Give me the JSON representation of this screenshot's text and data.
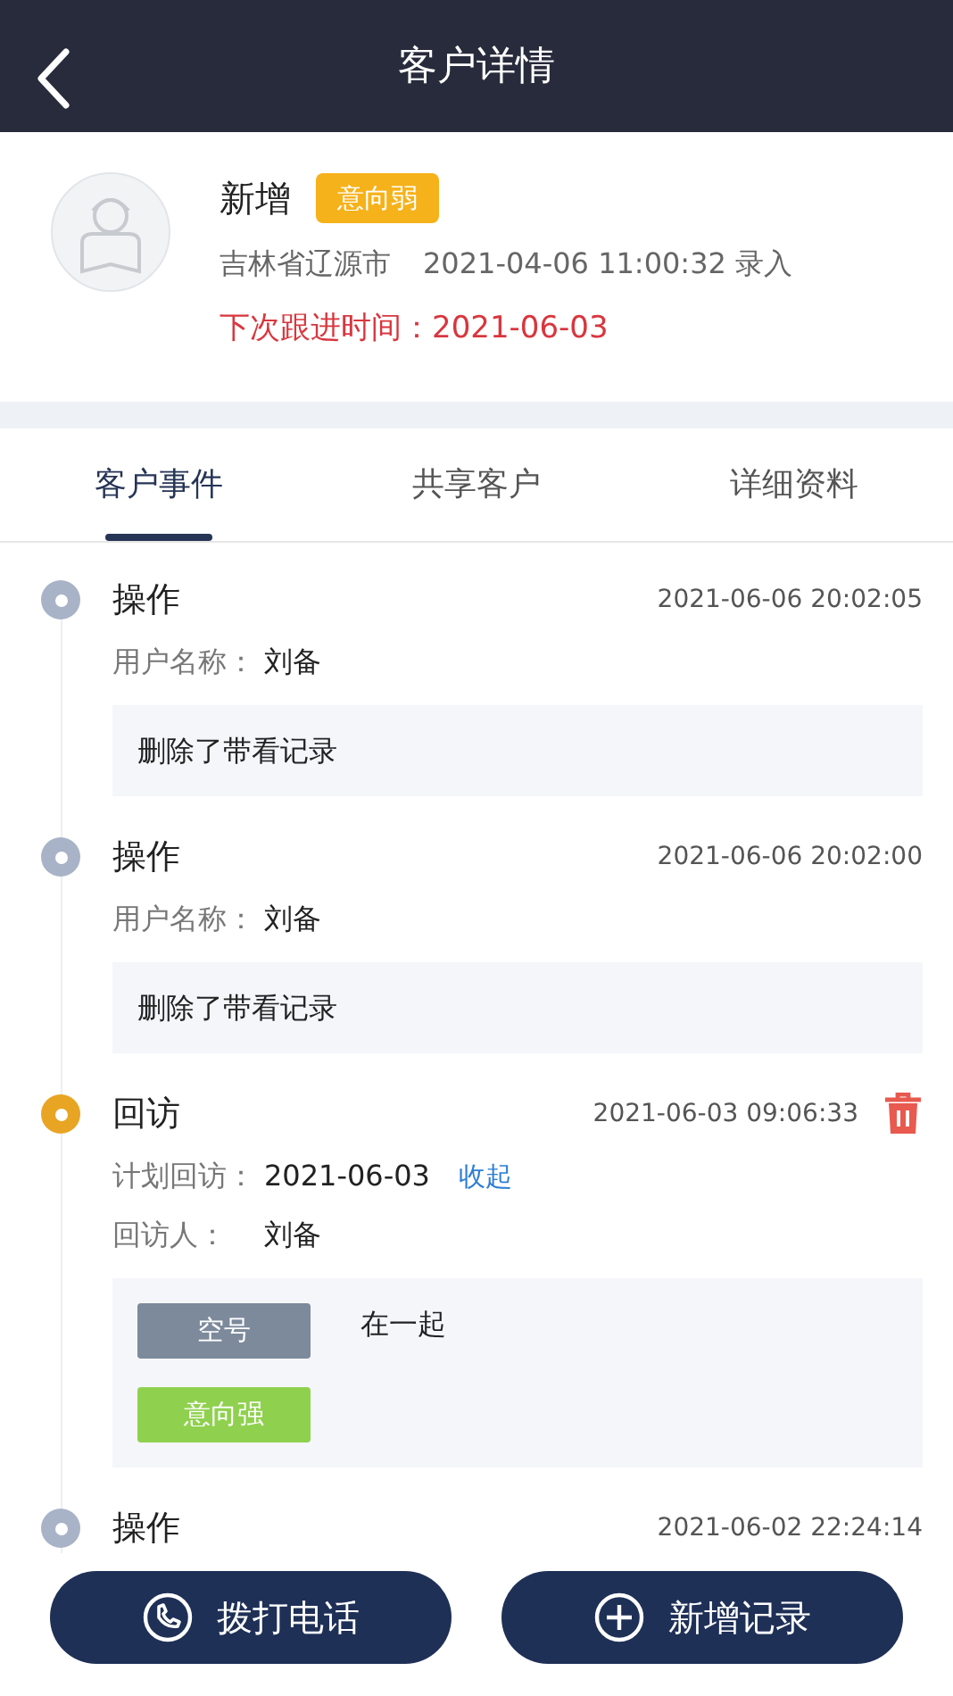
{
  "header": {
    "title": "客户详情"
  },
  "customer": {
    "name": "新增",
    "tag": {
      "label": "意向弱",
      "color": "#f6b21b"
    },
    "location": "吉林省辽源市",
    "created": "2021-04-06 11:00:32 录入",
    "followup": "下次跟进时间：2021-06-03"
  },
  "tabs": [
    {
      "label": "客户事件",
      "selected": true
    },
    {
      "label": "共享客户",
      "selected": false
    },
    {
      "label": "详细资料",
      "selected": false
    }
  ],
  "events": [
    {
      "kind": "operation",
      "title": "操作",
      "time": "2021-06-06 20:02:05",
      "fields": [
        {
          "label": "用户名称：",
          "value": "刘备"
        }
      ],
      "note": "删除了带看记录"
    },
    {
      "kind": "operation",
      "title": "操作",
      "time": "2021-06-06 20:02:00",
      "fields": [
        {
          "label": "用户名称：",
          "value": "刘备"
        }
      ],
      "note": "删除了带看记录"
    },
    {
      "kind": "visit",
      "title": "回访",
      "time": "2021-06-03 09:06:33",
      "deletable": true,
      "fields": [
        {
          "label": "计划回访：",
          "value": "2021-06-03",
          "link": "收起"
        },
        {
          "label": "回访人：",
          "value": "刘备"
        }
      ],
      "detail": {
        "tags": [
          {
            "label": "空号",
            "color": "#7d8a9b"
          },
          {
            "label": "意向强",
            "color": "#8fd14f"
          }
        ],
        "text": "在一起"
      }
    },
    {
      "kind": "operation",
      "title": "操作",
      "time": "2021-06-02 22:24:14"
    }
  ],
  "buttons": [
    {
      "kind": "call",
      "label": "拨打电话"
    },
    {
      "kind": "add",
      "label": "新增记录"
    }
  ]
}
